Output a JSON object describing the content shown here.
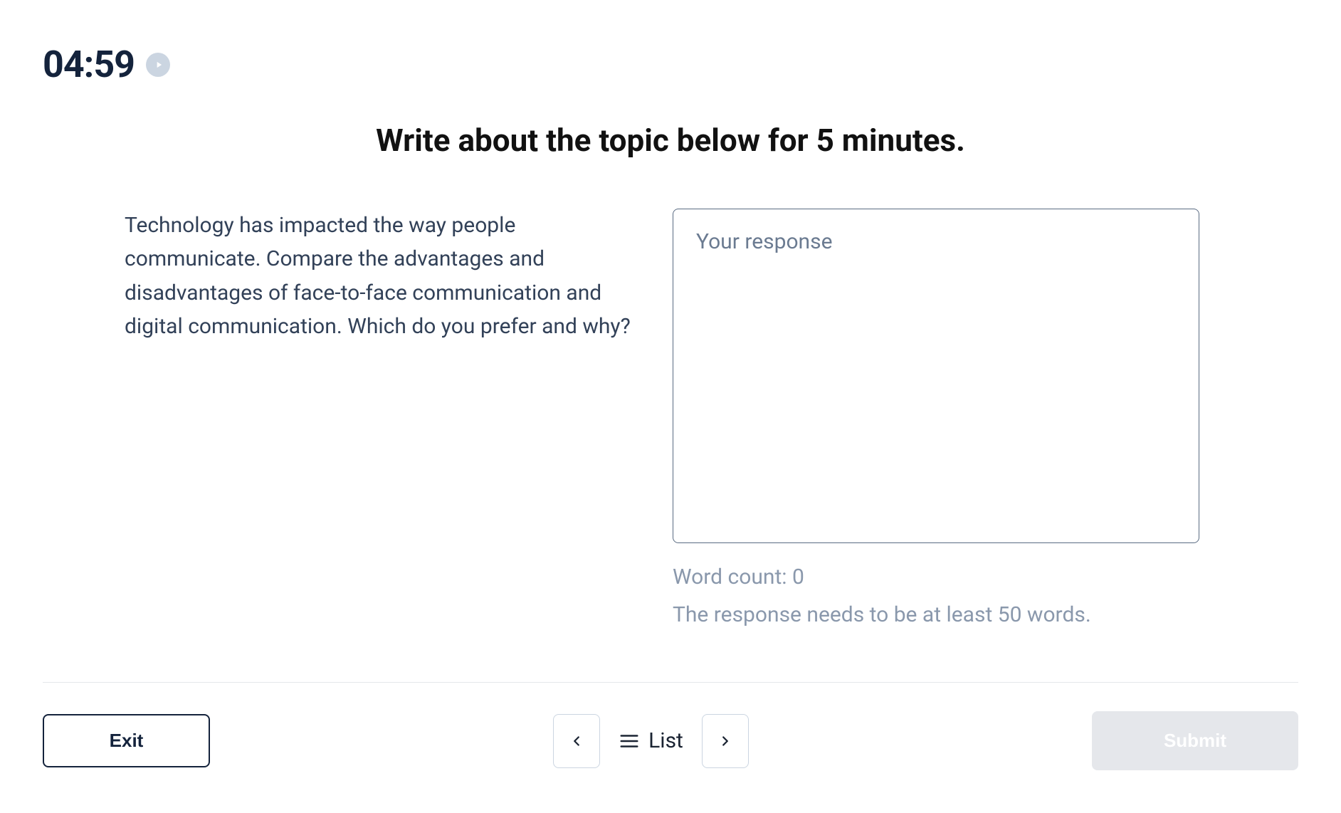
{
  "timer": {
    "time": "04:59"
  },
  "instruction": "Write about the topic below for 5 minutes.",
  "prompt": "Technology has impacted the way people communicate. Compare the advantages and disadvantages of face-to-face communication and digital communication. Which do you prefer and why?",
  "response": {
    "placeholder": "Your response",
    "value": "",
    "word_count_label": "Word count: 0",
    "hint": "The response needs to be at least 50 words."
  },
  "footer": {
    "exit_label": "Exit",
    "list_label": "List",
    "submit_label": "Submit"
  }
}
